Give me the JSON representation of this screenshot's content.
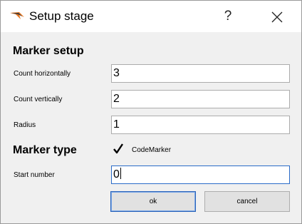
{
  "window": {
    "title": "Setup stage",
    "help_label": "?",
    "icon": "hawk-logo-icon",
    "close_icon": "close-icon"
  },
  "marker_setup": {
    "heading": "Marker setup",
    "count_horizontally": {
      "label": "Count horizontally",
      "value": "3"
    },
    "count_vertically": {
      "label": "Count vertically",
      "value": "2"
    },
    "radius": {
      "label": "Radius",
      "value": "1"
    }
  },
  "marker_type": {
    "heading": "Marker type",
    "checkbox_label": "CodeMarker",
    "checked": true
  },
  "start_number": {
    "label": "Start number",
    "value": "0"
  },
  "buttons": {
    "ok": "ok",
    "cancel": "cancel"
  },
  "colors": {
    "focus_border": "#2a6bc8",
    "logo_orange": "#e8761e",
    "dialog_bg": "#f0f0f0"
  }
}
